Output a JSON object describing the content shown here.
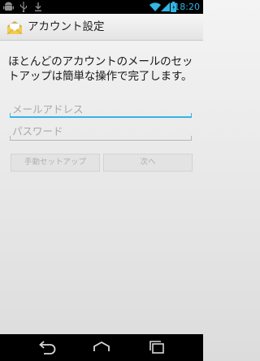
{
  "status_bar": {
    "time": "18:20",
    "icons": [
      "android-icon",
      "usb-icon",
      "download-icon",
      "wifi-icon",
      "signal-icon",
      "battery-icon"
    ]
  },
  "action_bar": {
    "title": "アカウント設定",
    "icon": "email-app-icon"
  },
  "main": {
    "instructions": "ほとんどのアカウントのメールのセットアップは簡単な操作で完了します。",
    "email_placeholder": "メールアドレス",
    "email_value": "",
    "password_placeholder": "パスワード",
    "password_value": "",
    "manual_setup_label": "手動セットアップ",
    "next_label": "次へ"
  },
  "nav_bar": {
    "icons": [
      "back-icon",
      "home-icon",
      "recent-apps-icon"
    ]
  },
  "colors": {
    "accent": "#33b5e5",
    "status_bar": "#000000",
    "disabled_text": "#b0b0b0"
  }
}
